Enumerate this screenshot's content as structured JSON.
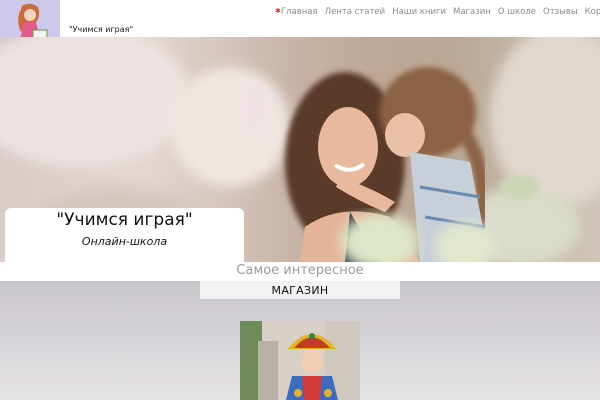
{
  "header": {
    "site_name": "\"Учимся играя\"",
    "nav": [
      {
        "label": "Главная",
        "active": true
      },
      {
        "label": "Лента статей"
      },
      {
        "label": "Наши книги"
      },
      {
        "label": "Магазин"
      },
      {
        "label": "О школе"
      },
      {
        "label": "Отзывы"
      },
      {
        "label": "Корзина"
      }
    ]
  },
  "hero": {
    "title": "\"Учимся играя\"",
    "subtitle": "Онлайн-школа"
  },
  "section": {
    "title": "Самое интересное",
    "shop_label": "МАГАЗИН"
  },
  "colors": {
    "accent": "#d23a3a",
    "nav_text": "#8a8a8a",
    "section_title": "#9a9a9a"
  },
  "icons": {
    "home_marker": "asterisk-icon"
  }
}
